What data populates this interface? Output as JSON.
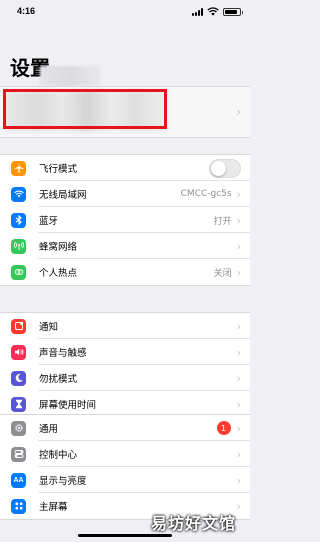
{
  "status_bar": {
    "time": "4:16"
  },
  "header": {
    "title": "设置"
  },
  "groups": {
    "network": [
      {
        "label": "飞行模式",
        "icon": "airplane-icon",
        "color": "#ff9500",
        "control": "toggle",
        "toggle_on": false
      },
      {
        "label": "无线局域网",
        "icon": "wifi-icon",
        "color": "#007aff",
        "value": "CMCC-gc5s"
      },
      {
        "label": "蓝牙",
        "icon": "bluetooth-icon",
        "color": "#007aff",
        "value": "打开"
      },
      {
        "label": "蜂窝网络",
        "icon": "cellular-icon",
        "color": "#34c759",
        "value": ""
      },
      {
        "label": "个人热点",
        "icon": "hotspot-icon",
        "color": "#34c759",
        "value": "关闭"
      }
    ],
    "notifications": [
      {
        "label": "通知",
        "icon": "notifications-icon",
        "color": "#ff3b30"
      },
      {
        "label": "声音与触感",
        "icon": "sound-icon",
        "color": "#ff2d55"
      },
      {
        "label": "勿扰模式",
        "icon": "moon-icon",
        "color": "#5856d6"
      },
      {
        "label": "屏幕使用时间",
        "icon": "hourglass-icon",
        "color": "#5856d6"
      }
    ],
    "general": [
      {
        "label": "通用",
        "icon": "gear-icon",
        "color": "#8e8e93",
        "badge": "1"
      },
      {
        "label": "控制中心",
        "icon": "control-center-icon",
        "color": "#8e8e93"
      },
      {
        "label": "显示与亮度",
        "icon": "display-icon",
        "color": "#007aff"
      },
      {
        "label": "主屏幕",
        "icon": "home-screen-icon",
        "color": "#007aff"
      }
    ]
  },
  "watermark": {
    "text": "易坊好文馆"
  }
}
